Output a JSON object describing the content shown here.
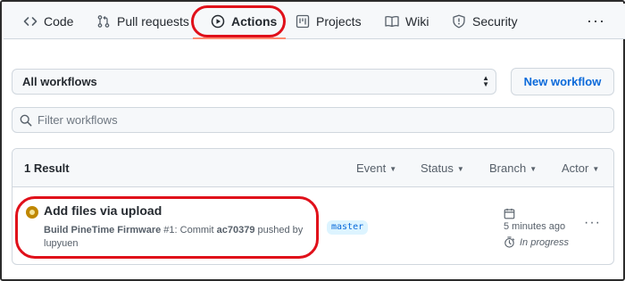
{
  "tabs": [
    {
      "label": "Code",
      "icon": "code-icon"
    },
    {
      "label": "Pull requests",
      "icon": "pull-request-icon"
    },
    {
      "label": "Actions",
      "icon": "play-icon",
      "active": true
    },
    {
      "label": "Projects",
      "icon": "project-icon"
    },
    {
      "label": "Wiki",
      "icon": "book-icon"
    },
    {
      "label": "Security",
      "icon": "shield-icon"
    }
  ],
  "more_menu": "···",
  "workflow_select": {
    "value": "All workflows"
  },
  "new_workflow_label": "New workflow",
  "filter": {
    "placeholder": "Filter workflows"
  },
  "results": {
    "count_label": "1 Result",
    "filters": [
      "Event",
      "Status",
      "Branch",
      "Actor"
    ]
  },
  "run": {
    "title": "Add files via upload",
    "workflow_name": "Build PineTime Firmware",
    "run_number": "#1",
    "commit_text": ": Commit",
    "commit_sha": "ac70379",
    "pushed_by_text": "pushed by",
    "actor": "lupyuen",
    "branch": "master",
    "time": "5 minutes ago",
    "status": "In progress",
    "more": "···"
  },
  "colors": {
    "accent_link": "#0969da",
    "tab_underline": "#fd8c73",
    "annotation_red": "#e0101a",
    "status_in_progress": "#bf8700"
  }
}
